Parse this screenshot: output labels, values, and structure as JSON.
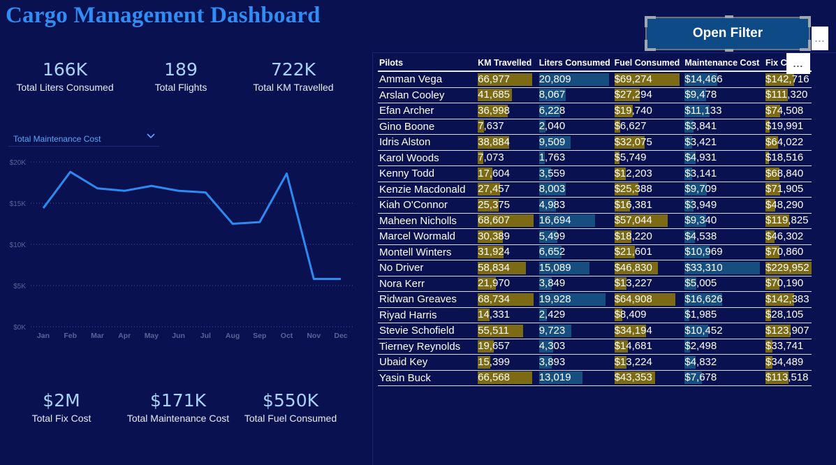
{
  "title": "Cargo Management Dashboard",
  "kpis_top": [
    {
      "value": "166K",
      "label": "Total Liters Consumed"
    },
    {
      "value": "189",
      "label": "Total Flights"
    },
    {
      "value": "722K",
      "label": "Total KM Travelled"
    }
  ],
  "kpis_bottom": [
    {
      "value": "$2M",
      "label": "Total Fix Cost"
    },
    {
      "value": "$171K",
      "label": "Total Maintenance Cost"
    },
    {
      "value": "$550K",
      "label": "Total Fuel Consumed"
    }
  ],
  "measure_selector": {
    "selected": "Total Maintenance Cost"
  },
  "open_filter_label": "Open Filter",
  "more_options_label": "...",
  "colors": {
    "line": "#2d8af0",
    "gold_bar": "#7c6a14",
    "blue_bar": "#164e80",
    "title": "#2f8df5"
  },
  "chart_data": {
    "type": "line",
    "categories": [
      "Jan",
      "Feb",
      "Mar",
      "Apr",
      "May",
      "Jun",
      "Jul",
      "Aug",
      "Sep",
      "Oct",
      "Nov",
      "Dec"
    ],
    "series": [
      {
        "values": [
          14400,
          18800,
          16800,
          16500,
          17100,
          16500,
          16300,
          12500,
          12700,
          18600,
          5800,
          5800
        ]
      }
    ],
    "ylim": [
      0,
      20000
    ],
    "yticks": [
      "$0K",
      "$5K",
      "$10K",
      "$15K",
      "$20K"
    ],
    "grid": true
  },
  "table": {
    "columns": [
      "Pilots",
      "KM Travelled",
      "Liters Consumed",
      "Fuel Consumed",
      "Maintenance Cost",
      "Fix Co"
    ],
    "rows": [
      {
        "pilot": "Amman Vega",
        "km": "66,977",
        "liters": "20,809",
        "fuel": "$69,274",
        "maint": "$14,466",
        "fix": "$142,716"
      },
      {
        "pilot": "Arslan Cooley",
        "km": "41,685",
        "liters": "8,067",
        "fuel": "$27,294",
        "maint": "$9,478",
        "fix": "$111,320"
      },
      {
        "pilot": "Efan Archer",
        "km": "36,998",
        "liters": "6,228",
        "fuel": "$19,740",
        "maint": "$11,133",
        "fix": "$74,508"
      },
      {
        "pilot": "Gino Boone",
        "km": "7,637",
        "liters": "2,040",
        "fuel": "$6,627",
        "maint": "$3,841",
        "fix": "$19,991"
      },
      {
        "pilot": "Idris Alston",
        "km": "38,884",
        "liters": "9,509",
        "fuel": "$32,075",
        "maint": "$3,421",
        "fix": "$64,022"
      },
      {
        "pilot": "Karol Woods",
        "km": "7,073",
        "liters": "1,763",
        "fuel": "$5,749",
        "maint": "$4,931",
        "fix": "$18,516"
      },
      {
        "pilot": "Kenny Todd",
        "km": "17,604",
        "liters": "3,559",
        "fuel": "$12,203",
        "maint": "$3,141",
        "fix": "$68,840"
      },
      {
        "pilot": "Kenzie Macdonald",
        "km": "27,457",
        "liters": "8,003",
        "fuel": "$25,388",
        "maint": "$9,709",
        "fix": "$71,905"
      },
      {
        "pilot": "Kiah O'Connor",
        "km": "25,375",
        "liters": "4,983",
        "fuel": "$16,381",
        "maint": "$3,949",
        "fix": "$48,290"
      },
      {
        "pilot": "Maheen Nicholls",
        "km": "68,607",
        "liters": "16,694",
        "fuel": "$57,044",
        "maint": "$9,340",
        "fix": "$119,825"
      },
      {
        "pilot": "Marcel Wormald",
        "km": "30,389",
        "liters": "5,499",
        "fuel": "$18,220",
        "maint": "$4,538",
        "fix": "$46,302"
      },
      {
        "pilot": "Montell Winters",
        "km": "31,924",
        "liters": "6,652",
        "fuel": "$21,601",
        "maint": "$10,969",
        "fix": "$70,860"
      },
      {
        "pilot": "No Driver",
        "km": "58,834",
        "liters": "15,089",
        "fuel": "$46,830",
        "maint": "$33,310",
        "fix": "$229,952"
      },
      {
        "pilot": "Nora Kerr",
        "km": "21,970",
        "liters": "3,849",
        "fuel": "$13,227",
        "maint": "$5,005",
        "fix": "$70,190"
      },
      {
        "pilot": "Ridwan Greaves",
        "km": "68,734",
        "liters": "19,928",
        "fuel": "$64,908",
        "maint": "$16,626",
        "fix": "$142,383"
      },
      {
        "pilot": "Riyad Harris",
        "km": "14,331",
        "liters": "2,429",
        "fuel": "$8,409",
        "maint": "$1,985",
        "fix": "$28,105"
      },
      {
        "pilot": "Stevie Schofield",
        "km": "55,511",
        "liters": "9,723",
        "fuel": "$34,194",
        "maint": "$10,452",
        "fix": "$123,907"
      },
      {
        "pilot": "Tierney Reynolds",
        "km": "19,657",
        "liters": "4,303",
        "fuel": "$14,681",
        "maint": "$2,498",
        "fix": "$33,741"
      },
      {
        "pilot": "Ubaid Key",
        "km": "15,399",
        "liters": "3,893",
        "fuel": "$13,224",
        "maint": "$4,832",
        "fix": "$34,489"
      },
      {
        "pilot": "Yasin Buck",
        "km": "66,568",
        "liters": "13,019",
        "fuel": "$43,353",
        "maint": "$7,678",
        "fix": "$113,518"
      }
    ]
  }
}
